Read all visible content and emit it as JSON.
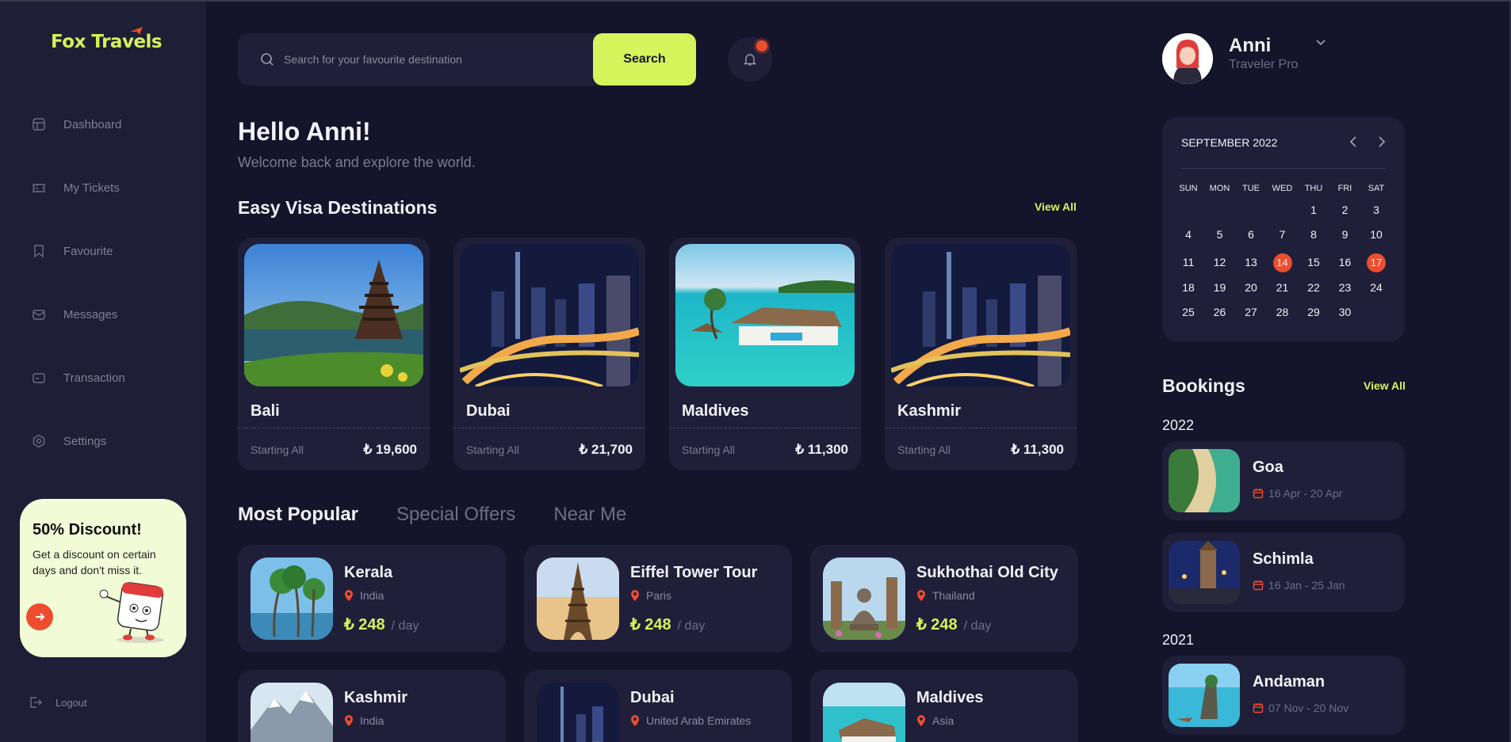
{
  "brand": {
    "name": "Fox Travels",
    "accent": "#d4f55c",
    "alert": "#ee4d2d"
  },
  "sidebar": {
    "items": [
      {
        "label": "Dashboard",
        "icon": "grid-icon"
      },
      {
        "label": "My Tickets",
        "icon": "ticket-icon"
      },
      {
        "label": "Favourite",
        "icon": "bookmark-icon"
      },
      {
        "label": "Messages",
        "icon": "mail-icon"
      },
      {
        "label": "Transaction",
        "icon": "wallet-icon"
      },
      {
        "label": "Settings",
        "icon": "gear-icon"
      }
    ],
    "promo": {
      "title": "50% Discount!",
      "text": "Get a discount on certain days and don't miss it."
    },
    "logout_label": "Logout"
  },
  "search": {
    "placeholder": "Search for your favourite destination",
    "button_label": "Search"
  },
  "greeting": {
    "title": "Hello Anni!",
    "subtitle": "Welcome back and explore the world."
  },
  "easy_visa": {
    "title": "Easy Visa Destinations",
    "view_all": "View All",
    "cards": [
      {
        "name": "Bali",
        "starting_label": "Starting All",
        "price": "₺ 19,600"
      },
      {
        "name": "Dubai",
        "starting_label": "Starting All",
        "price": "₺ 21,700"
      },
      {
        "name": "Maldives",
        "starting_label": "Starting All",
        "price": "₺ 11,300"
      },
      {
        "name": "Kashmir",
        "starting_label": "Starting All",
        "price": "₺ 11,300"
      }
    ]
  },
  "tabs": [
    "Most Popular",
    "Special Offers",
    "Near Me"
  ],
  "popular": [
    {
      "name": "Kerala",
      "location": "India",
      "price": "₺ 248",
      "per": "/ day"
    },
    {
      "name": "Eiffel Tower Tour",
      "location": "Paris",
      "price": "₺ 248",
      "per": "/ day"
    },
    {
      "name": "Sukhothai Old City",
      "location": "Thailand",
      "price": "₺ 248",
      "per": "/ day"
    },
    {
      "name": "Kashmir",
      "location": "India",
      "price": "",
      "per": ""
    },
    {
      "name": "Dubai",
      "location": "United Arab Emirates",
      "price": "",
      "per": ""
    },
    {
      "name": "Maldives",
      "location": "Asia",
      "price": "",
      "per": ""
    }
  ],
  "user": {
    "name": "Anni",
    "role": "Traveler Pro"
  },
  "calendar": {
    "title": "SEPTEMBER 2022",
    "weekdays": [
      "SUN",
      "MON",
      "TUE",
      "WED",
      "THU",
      "FRI",
      "SAT"
    ],
    "first_weekday": 4,
    "days_in_month": 30,
    "highlighted": [
      14,
      17
    ]
  },
  "bookings": {
    "title": "Bookings",
    "view_all": "View All",
    "groups": [
      {
        "year": "2022",
        "items": [
          {
            "name": "Goa",
            "dates": "16 Apr - 20 Apr"
          },
          {
            "name": "Schimla",
            "dates": "16 Jan - 25 Jan"
          }
        ]
      },
      {
        "year": "2021",
        "items": [
          {
            "name": "Andaman",
            "dates": "07 Nov - 20 Nov"
          }
        ]
      }
    ]
  }
}
